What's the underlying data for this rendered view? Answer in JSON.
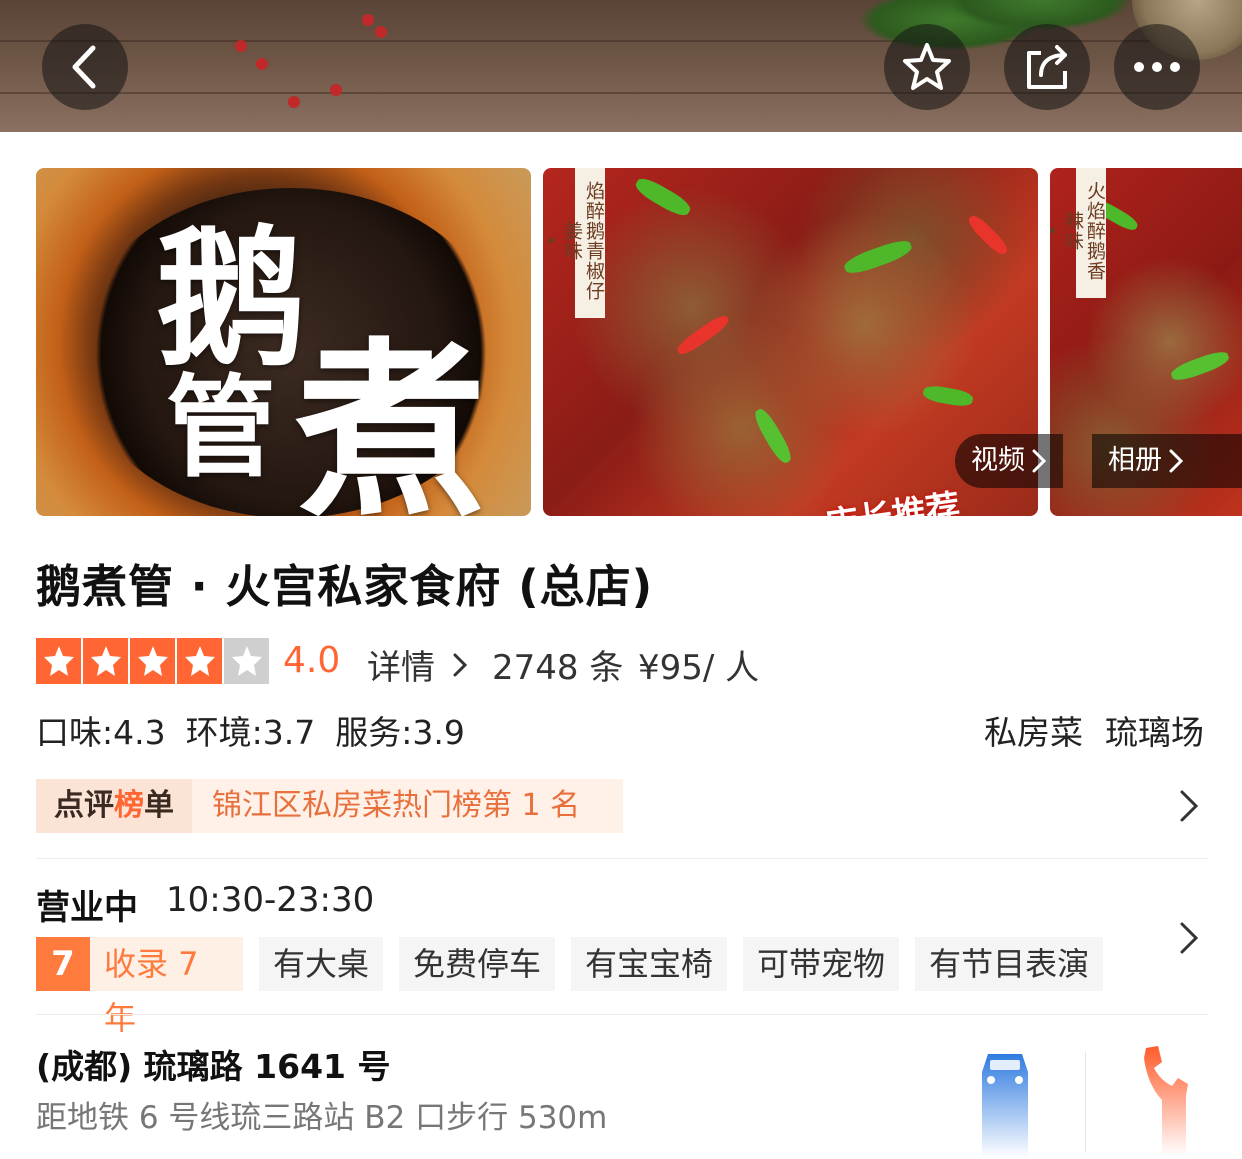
{
  "nav": {
    "back_icon": "chevron-left-icon",
    "favorite_icon": "star-outline-icon",
    "share_icon": "share-icon",
    "more_icon": "more-dots-icon"
  },
  "gallery": {
    "photo1_glyphs": [
      "鹅",
      "管",
      "煮"
    ],
    "photo2_tag": "焰醉鹅青椒仔姜味",
    "photo2_banner": "店长推荐",
    "photo3_tag": "火焰醉鹅香辣味",
    "video_label": "视频",
    "album_label": "相册"
  },
  "shop": {
    "name": "鹅煮管 · 火宫私家食府 (总店)",
    "stars": 4,
    "rating": "4.0",
    "detail_label": "详情",
    "reviews": "2748 条",
    "price": "¥95/ 人",
    "scores": {
      "taste": "口味:4.3",
      "environment": "环境:3.7",
      "service": "服务:3.9"
    },
    "category": "私房菜",
    "area": "琉璃场"
  },
  "ranking": {
    "label": "点评榜单",
    "text": "锦江区私房菜热门榜第 1 名"
  },
  "hours": {
    "status": "营业中",
    "time": "10:30-23:30"
  },
  "facilities": {
    "years_num": "7",
    "years_text": "收录 7 年",
    "items": [
      "有大桌",
      "免费停车",
      "有宝宝椅",
      "可带宠物",
      "有节目表演"
    ]
  },
  "address": {
    "line1": "(成都) 琉璃路 1641 号",
    "line2": "距地铁 6 号线琉三路站 B2 口步行 530m"
  },
  "colors": {
    "accent": "#ff6633",
    "rank_text": "#e8703c",
    "star_off": "#cfcfcf",
    "car_icon": "#2f7be0",
    "phone_icon": "#ff5a2a"
  }
}
